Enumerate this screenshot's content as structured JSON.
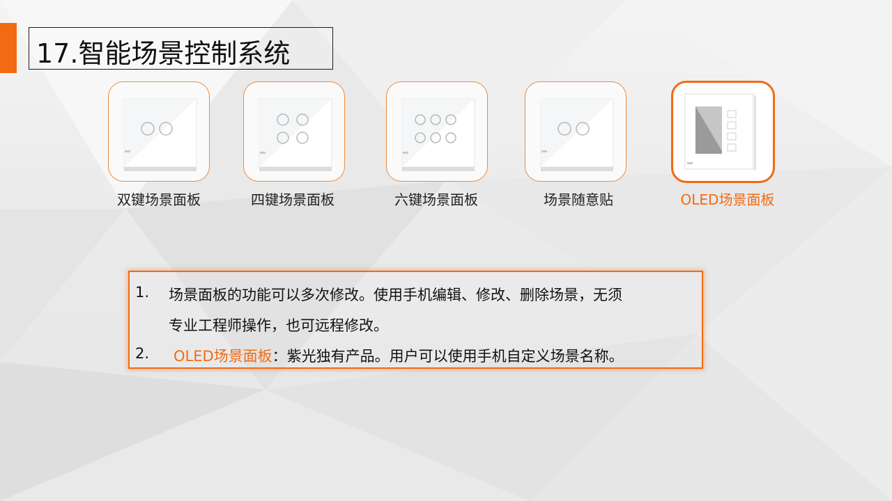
{
  "slide": {
    "title": "17.智能场景控制系统"
  },
  "panels": [
    {
      "caption": "双键场景面板",
      "buttons": 2,
      "selected": false
    },
    {
      "caption": "四键场景面板",
      "buttons": 4,
      "selected": false
    },
    {
      "caption": "六键场景面板",
      "buttons": 6,
      "selected": false
    },
    {
      "caption": "场景随意贴",
      "buttons": 2,
      "selected": false
    },
    {
      "caption": "OLED场景面板",
      "buttons": 4,
      "selected": true
    }
  ],
  "notes": {
    "item1": {
      "number": "1.",
      "line1": "场景面板的功能可以多次修改。使用手机编辑、修改、删除场景，无须",
      "line2": "专业工程师操作，也可远程修改。"
    },
    "item2": {
      "number": "2.",
      "highlight": "OLED场景面板",
      "rest": "：紫光独有产品。用户可以使用手机自定义场景名称。"
    }
  },
  "colors": {
    "accent": "#f26a12",
    "text": "#111111"
  }
}
